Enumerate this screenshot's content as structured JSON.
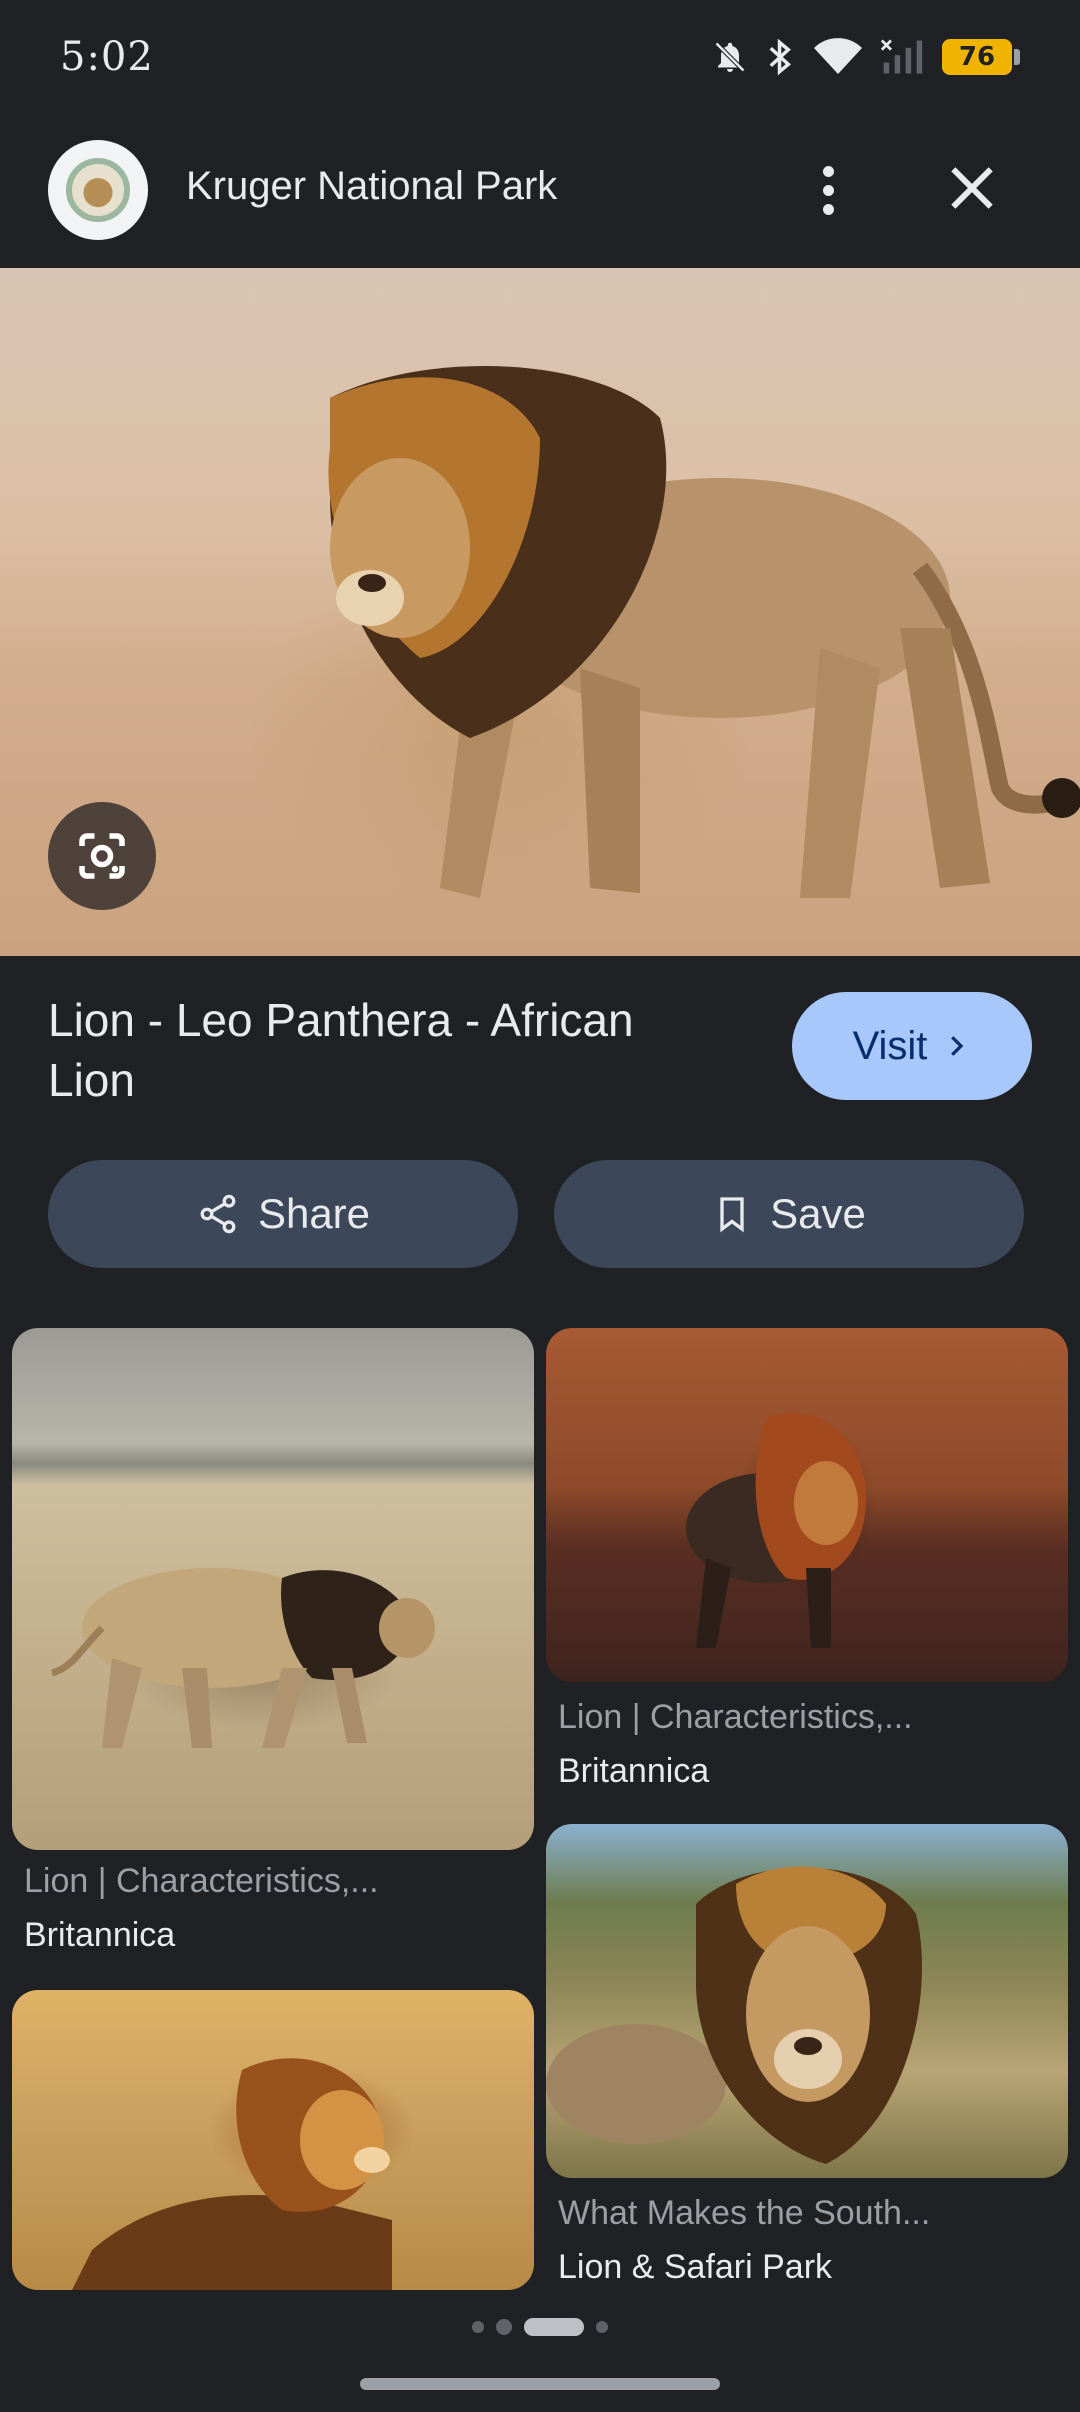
{
  "status_bar": {
    "time": "5:02",
    "battery": "76",
    "icons": [
      "bell-off-icon",
      "bluetooth-icon",
      "wifi-icon",
      "signal-icon",
      "battery-icon"
    ]
  },
  "header": {
    "site_title": "Kruger National Park",
    "more_icon": "more-vert-icon",
    "close_icon": "close-icon"
  },
  "hero": {
    "image": "lion walking",
    "lens_icon": "google-lens-icon"
  },
  "result": {
    "title": "Lion - Leo Panthera - African Lion",
    "visit_label": "Visit"
  },
  "actions": {
    "share_label": "Share",
    "save_label": "Save"
  },
  "related": [
    {
      "title": "Lion | Characteristics,...",
      "source": "Britannica"
    },
    {
      "title": "Lion | Characteristics,...",
      "source": "Britannica"
    },
    {
      "title": "",
      "source": ""
    },
    {
      "title": "What Makes the South...",
      "source": "Lion & Safari Park"
    }
  ],
  "colors": {
    "background": "#202124",
    "visit_button": "#a8c7fa",
    "action_button": "#3c4759",
    "battery": "#f0b400"
  }
}
